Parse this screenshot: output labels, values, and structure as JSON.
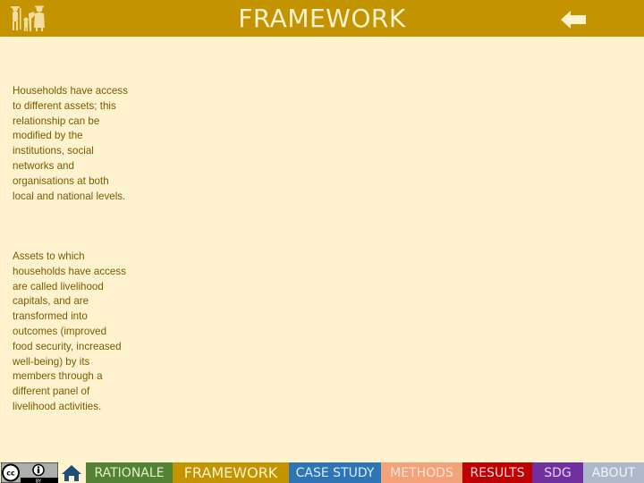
{
  "header": {
    "title": "FRAMEWORK",
    "logo_icon": "people-figures-logo-icon",
    "back_icon": "left-arrow-icon"
  },
  "content": {
    "paragraphs": [
      "Households have access to different assets; this relationship can be modified by the institutions, social networks and organisations at both local and national levels.",
      "Assets to which households have access are called livelihood capitals, and are transformed into outcomes (improved food security, increased well-being) by its members through a different panel of livelihood activities."
    ]
  },
  "footer": {
    "license_badge": "cc-by-license-icon",
    "home_icon": "home-icon",
    "nav": [
      {
        "label": "RATIONALE",
        "color": "#548235"
      },
      {
        "label": "FRAMEWORK",
        "color": "#C39300",
        "active": true
      },
      {
        "label": "CASE STUDY",
        "color": "#2E75B6"
      },
      {
        "label": "METHODS",
        "color": "#F4A27A"
      },
      {
        "label": "RESULTS",
        "color": "#C00000"
      },
      {
        "label": "SDG",
        "color": "#7030A0"
      },
      {
        "label": "ABOUT",
        "color": "#ADB9CA"
      }
    ]
  },
  "colors": {
    "background": "#FFF2CE",
    "header": "#C39300",
    "body_text": "#7A5B00"
  }
}
